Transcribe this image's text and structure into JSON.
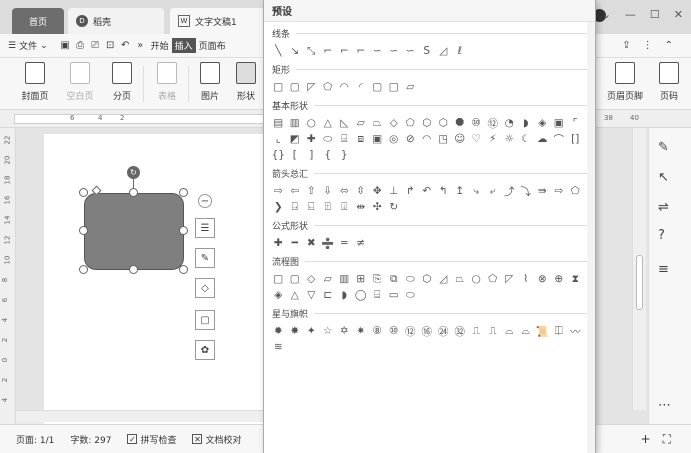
{
  "tabs": [
    {
      "label": "首页"
    },
    {
      "label": "稻壳"
    },
    {
      "label": "文字文稿1"
    }
  ],
  "menu": {
    "file": "文件",
    "start": "开始",
    "insert": "插入",
    "layout": "页面布"
  },
  "ribbon": {
    "cover": "封面页",
    "blank": "空白页",
    "pagebreak": "分页",
    "table": "表格",
    "picture": "图片",
    "shapes": "形状",
    "headerfooter": "页眉页脚",
    "pagenum": "页码"
  },
  "ruler": {
    "h": [
      "6",
      "4",
      "2",
      "38",
      "40"
    ],
    "v": [
      "22",
      "20",
      "18",
      "16",
      "14",
      "12",
      "10",
      "8",
      "6",
      "4",
      "2",
      "0",
      "2",
      "4"
    ]
  },
  "status": {
    "page": "页面: 1/1",
    "words": "字数: 297",
    "spell": "拼写检查",
    "proof": "文档校对"
  },
  "dropdown": {
    "title": "预设",
    "sections": [
      "线条",
      "矩形",
      "基本形状",
      "箭头总汇",
      "公式形状",
      "流程图",
      "星与旗帜"
    ]
  },
  "colors": {
    "shape_fill": "#7f7f7f",
    "active_menu": "#555555",
    "home_tab": "#6d6d6d"
  }
}
